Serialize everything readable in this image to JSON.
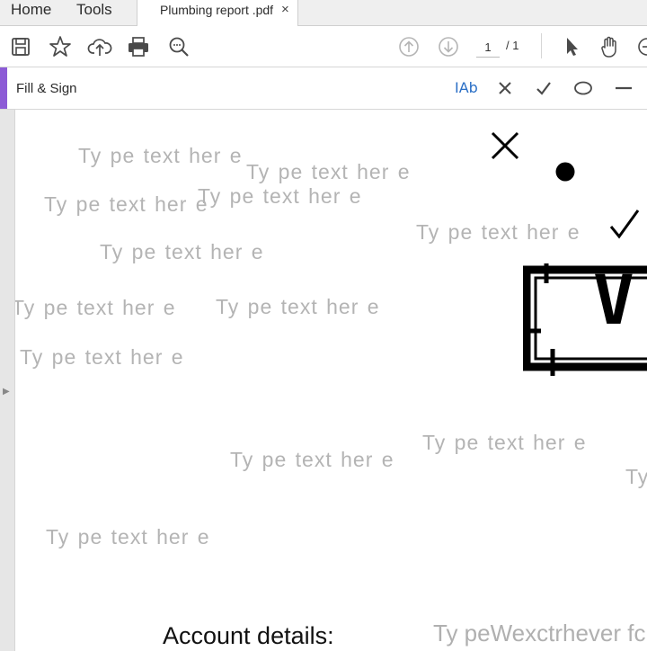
{
  "menubar": {
    "home": "Home",
    "tools": "Tools",
    "tab_title": "Plumbing report .pdf",
    "tab_close": "×"
  },
  "toolbar": {
    "icons": [
      "save-icon",
      "bookmark-star-icon",
      "upload-cloud-icon",
      "print-icon",
      "zoom-search-icon",
      "page-up-icon",
      "page-down-icon",
      "select-pointer-icon",
      "hand-tool-icon"
    ],
    "page_current": "1",
    "page_total": "/ 1"
  },
  "fill_sign": {
    "title": "Fill & Sign",
    "text_tool": "IAb",
    "tools": [
      "add-text-icon",
      "cross-mark-icon",
      "check-mark-icon",
      "circle-icon",
      "line-icon"
    ],
    "accent_color": "#8c5bd6",
    "text_tool_color": "#2a6fc6"
  },
  "document": {
    "placeholder": "Ty pe text h",
    "placeholder_tail": "er e",
    "fields": [
      "Ty pe text her e",
      "Ty pe text her e",
      "Ty pe text her e",
      "Ty pe text her e",
      "Ty pe text her e",
      "Ty pe text her e",
      "Ty pe text her e",
      "Ty pe text her e",
      "Ty pe text her e",
      "Ty pe text her e",
      "Ty pe text her e",
      "Ty pe text her e",
      "Ty pe text her e",
      "Ty"
    ],
    "account_label": "Account details:",
    "overlap_text": "Ty peWexctrhever fcpc",
    "stamp_letter": "V"
  }
}
